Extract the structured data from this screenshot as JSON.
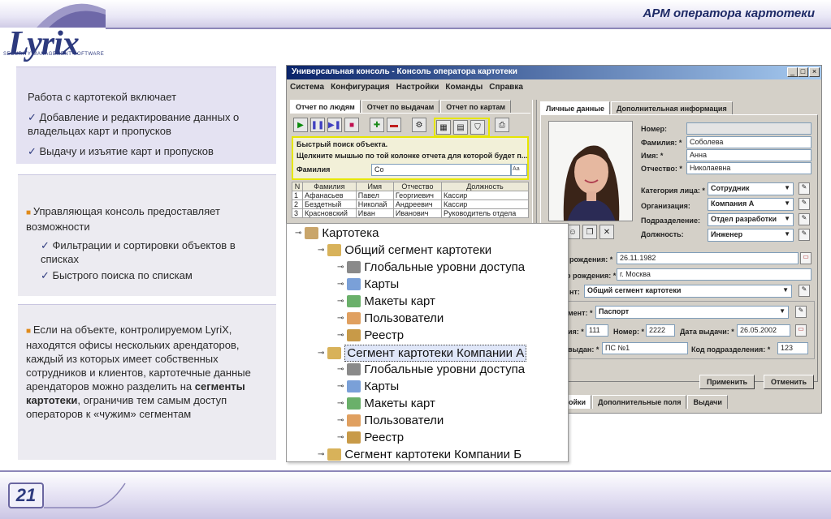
{
  "header": {
    "title": "АРМ оператора картотеки"
  },
  "logo": {
    "name": "Lyrix",
    "tagline": "SECURITY MANAGEMENT SOFTWARE"
  },
  "box1": {
    "intro": "Работа с картотекой включает",
    "items": [
      "Добавление и редактирование данных о владельцах карт и пропусков",
      "Выдачу и изъятие карт и пропусков"
    ]
  },
  "box2": {
    "lead": "Управляющая консоль предоставляет возможности",
    "items": [
      "Фильтрации и сортировки объектов в списках",
      "Быстрого поиска по спискам"
    ]
  },
  "box3": {
    "text_before": "Если на объекте, контролируемом LyriX, находятся офисы нескольких арендаторов, каждый из которых имеет собственных сотрудников и клиентов, картотечные данные арендаторов можно разделить на ",
    "bold": "сегменты картотеки",
    "text_after": ", ограничив тем самым доступ операторов к «чужим» сегментам"
  },
  "window": {
    "title": "Универсальная консоль - Консоль оператора картотеки",
    "menu": [
      "Система",
      "Конфигурация",
      "Настройки",
      "Команды",
      "Справка"
    ],
    "left_tabs": [
      "Отчет по людям",
      "Отчет по выдачам",
      "Отчет по картам"
    ],
    "quick_search": {
      "title": "Быстрый поиск объекта.",
      "hint": "Щелкните мышью по той колонке отчета для которой будет п...",
      "field_label": "Фамилия",
      "field_value": "Со",
      "kbd": "Аа"
    },
    "table": {
      "columns": [
        "N",
        "Фамилия",
        "Имя",
        "Отчество",
        "Должность"
      ],
      "rows": [
        [
          "1",
          "Афанасьев",
          "Павел",
          "Георгиевич",
          "Кассир"
        ],
        [
          "2",
          "Бездетный",
          "Николай",
          "Андреевич",
          "Кассир"
        ],
        [
          "3",
          "Красновский",
          "Иван",
          "Иванович",
          "Руководитель отдела"
        ]
      ]
    },
    "right_tabs": [
      "Личные данные",
      "Дополнительная информация"
    ],
    "form": {
      "number_label": "Номер:",
      "surname_label": "Фамилия: *",
      "surname": "Соболева",
      "name_label": "Имя: *",
      "name": "Анна",
      "patronymic_label": "Отчество: *",
      "patronymic": "Николаевна",
      "category_label": "Категория лица: *",
      "category": "Сотрудник",
      "org_label": "Организация:",
      "org": "Компания А",
      "dept_label": "Подразделение:",
      "dept": "Отдел разработки",
      "position_label": "Должность:",
      "position": "Инженер",
      "birth_label": "рождения: *",
      "birth": "26.11.1982",
      "birthplace_label": "о рождения: *",
      "birthplace": "г. Москва",
      "segment_label": "нт:",
      "segment": "Общий сегмент картотеки",
      "doc_label": "мент: *",
      "doc": "Паспорт",
      "series_label": "ия: *",
      "series": "111",
      "docnum_label": "Номер: *",
      "docnum": "2222",
      "issued_date_label": "Дата выдачи: *",
      "issued_date": "26.05.2002",
      "issued_by_label": "выдан: *",
      "issued_by": "ПС №1",
      "dept_code_label": "Код подразделения: *",
      "dept_code": "123"
    },
    "apply": "Применить",
    "cancel": "Отменить",
    "bottom_tabs": [
      "ойки",
      "Дополнительные поля",
      "Выдачи"
    ]
  },
  "tree": {
    "root": "Картотека",
    "common": "Общий сегмент картотеки",
    "children": [
      "Глобальные уровни доступа",
      "Карты",
      "Макеты карт",
      "Пользователи",
      "Реестр"
    ],
    "seg_a": "Сегмент картотеки Компании А",
    "seg_b": "Сегмент картотеки Компании Б"
  },
  "footer": {
    "page": "21"
  }
}
